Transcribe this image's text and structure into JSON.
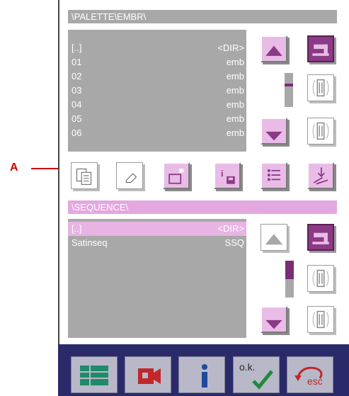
{
  "annotation": {
    "label": "A"
  },
  "top_panel": {
    "path": "\\PALETTE\\EMBR\\",
    "files": [
      {
        "name": "[..]",
        "type": "<DIR>"
      },
      {
        "name": "01",
        "type": "emb"
      },
      {
        "name": "02",
        "type": "emb"
      },
      {
        "name": "03",
        "type": "emb"
      },
      {
        "name": "04",
        "type": "emb"
      },
      {
        "name": "05",
        "type": "emb"
      },
      {
        "name": "06",
        "type": "emb"
      }
    ],
    "scroll_position_fraction": 0.2
  },
  "bottom_panel": {
    "path": "\\SEQUENCE\\",
    "files": [
      {
        "name": "[..]",
        "type": "<DIR>"
      },
      {
        "name": "Satinseq",
        "type": "SSQ"
      }
    ],
    "selected_index": 0
  },
  "bottom_bar": {
    "ok_label": "o.k.",
    "esc_label": "esc"
  },
  "icons": {
    "toolbar": [
      "copy-icon",
      "eraser-icon",
      "new-folder-icon",
      "info-save-icon",
      "list-icon",
      "load-icon"
    ],
    "side": [
      "scroll-up-icon",
      "sewing-machine-icon",
      "memory-card-icon",
      "scroll-down-icon"
    ],
    "bottom": [
      "menu-grid-icon",
      "video-icon",
      "info-icon",
      "ok-check-icon",
      "esc-icon"
    ]
  },
  "colors": {
    "path_bar_top": "#a8a8a8",
    "path_bar_bottom": "#e3a8df",
    "list_bg": "#a8a8a8",
    "selection": "#e7b4e3",
    "accent_purple": "#8b3a85",
    "bottom_bar": "#2a2a6a",
    "callout": "#cc0000"
  }
}
